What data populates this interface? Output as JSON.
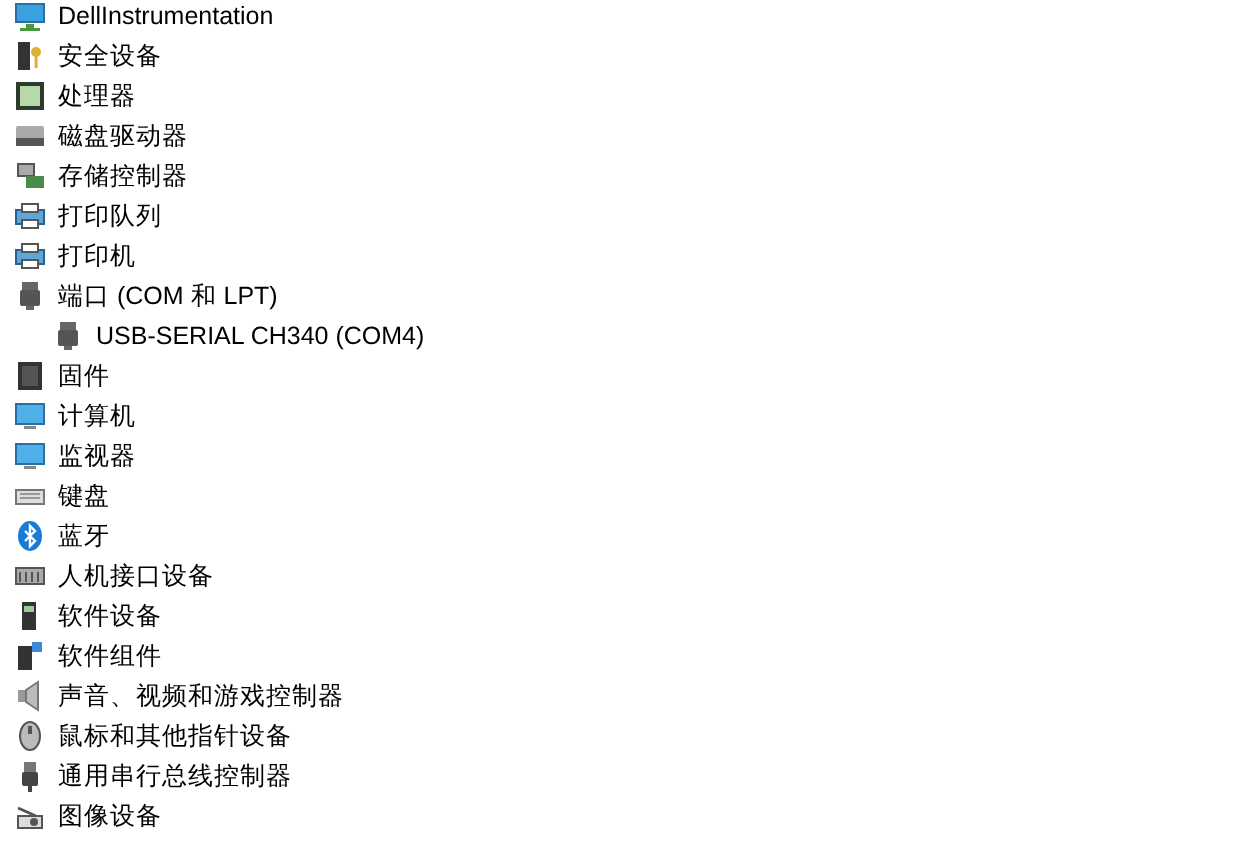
{
  "tree": [
    {
      "label": "DellInstrumentation"
    },
    {
      "label": "安全设备"
    },
    {
      "label": "处理器"
    },
    {
      "label": "磁盘驱动器"
    },
    {
      "label": "存储控制器"
    },
    {
      "label": "打印队列"
    },
    {
      "label": "打印机"
    },
    {
      "label": "端口 (COM 和 LPT)",
      "children": [
        {
          "label": "USB-SERIAL CH340 (COM4)"
        }
      ]
    },
    {
      "label": "固件"
    },
    {
      "label": "计算机"
    },
    {
      "label": "监视器"
    },
    {
      "label": "键盘"
    },
    {
      "label": "蓝牙"
    },
    {
      "label": "人机接口设备"
    },
    {
      "label": "软件设备"
    },
    {
      "label": "软件组件"
    },
    {
      "label": "声音、视频和游戏控制器"
    },
    {
      "label": "鼠标和其他指针设备"
    },
    {
      "label": "通用串行总线控制器"
    },
    {
      "label": "图像设备"
    }
  ]
}
